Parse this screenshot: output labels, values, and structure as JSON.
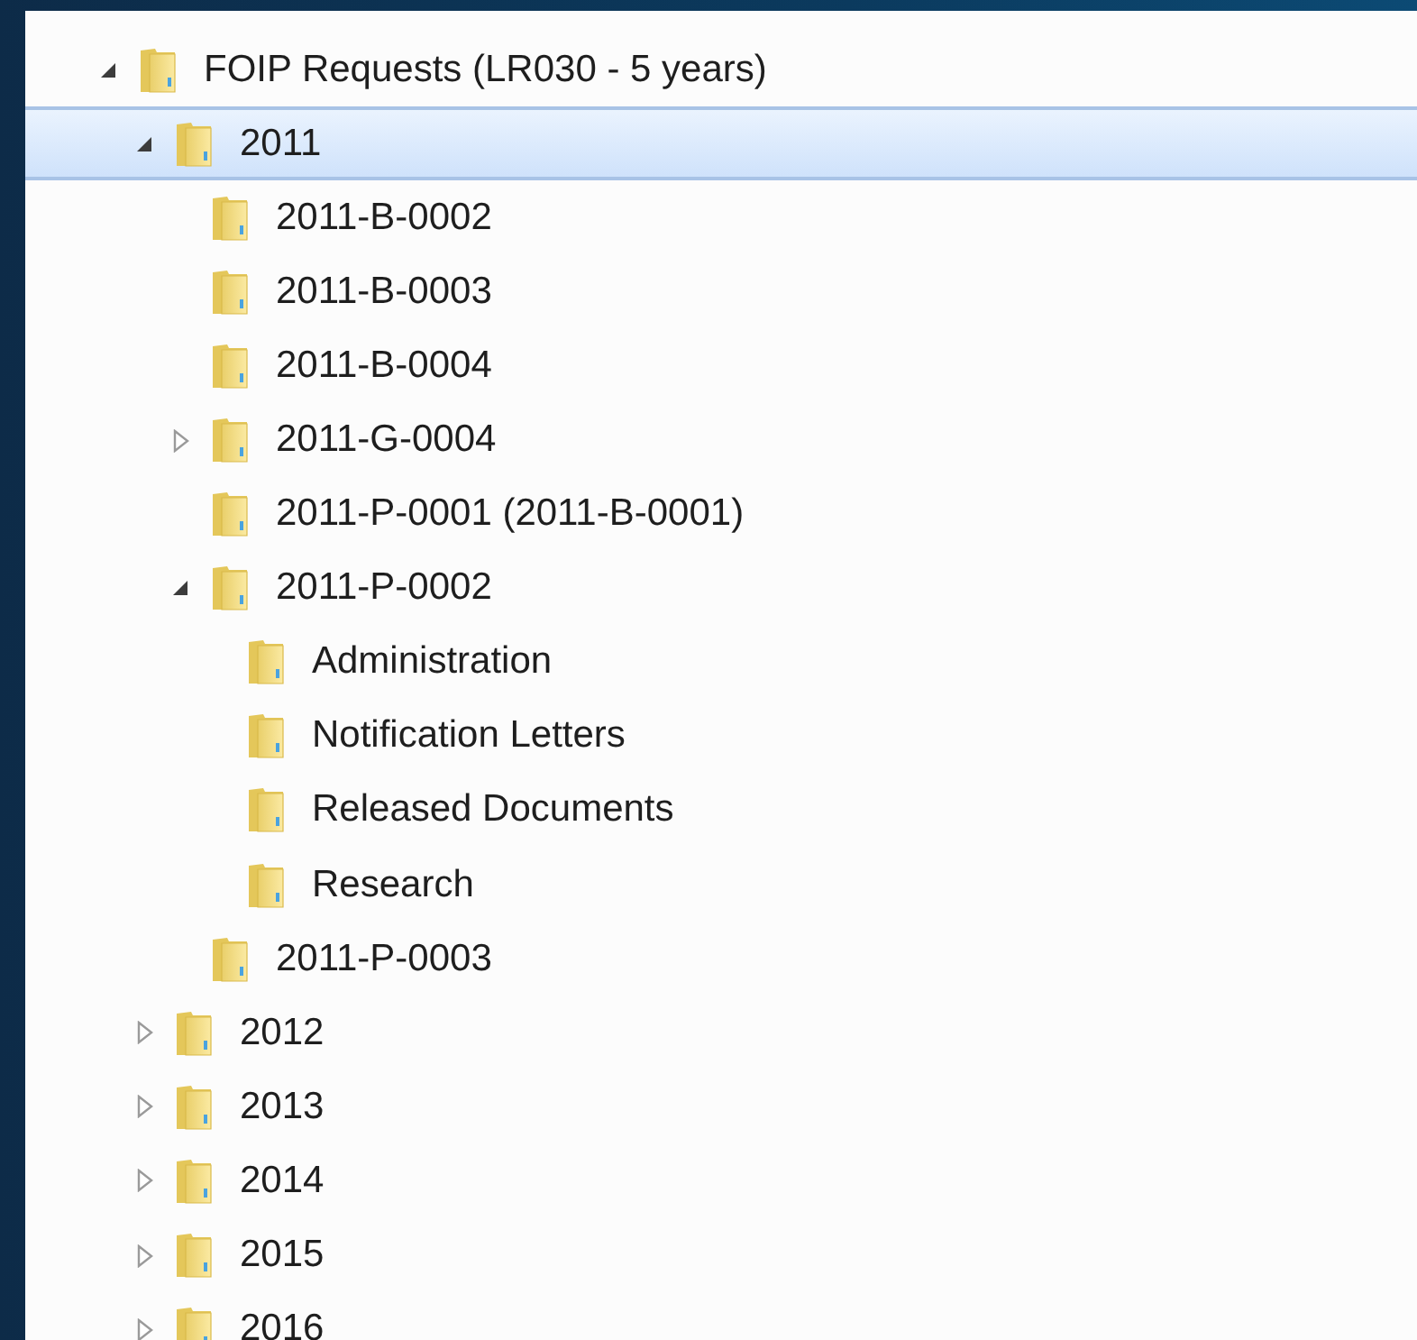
{
  "tree": [
    {
      "label": "FOIP Requests (LR030 - 5 years)",
      "expanded": true,
      "selected": false,
      "children": [
        {
          "label": "2011",
          "expanded": true,
          "selected": true,
          "children": [
            {
              "label": "2011-B-0002",
              "selected": false
            },
            {
              "label": "2011-B-0003",
              "selected": false
            },
            {
              "label": "2011-B-0004",
              "selected": false
            },
            {
              "label": "2011-G-0004",
              "expanded": false,
              "selected": false
            },
            {
              "label": "2011-P-0001 (2011-B-0001)",
              "selected": false
            },
            {
              "label": "2011-P-0002",
              "expanded": true,
              "selected": false,
              "children": [
                {
                  "label": "Administration",
                  "selected": false
                },
                {
                  "label": "Notification Letters",
                  "selected": false
                },
                {
                  "label": "Released Documents",
                  "selected": false
                },
                {
                  "label": "Research",
                  "selected": false
                }
              ]
            },
            {
              "label": "2011-P-0003",
              "selected": false
            }
          ]
        },
        {
          "label": "2012",
          "expanded": false,
          "selected": false
        },
        {
          "label": "2013",
          "expanded": false,
          "selected": false
        },
        {
          "label": "2014",
          "expanded": false,
          "selected": false
        },
        {
          "label": "2015",
          "expanded": false,
          "selected": false
        },
        {
          "label": "2016",
          "expanded": false,
          "selected": false
        }
      ]
    }
  ]
}
